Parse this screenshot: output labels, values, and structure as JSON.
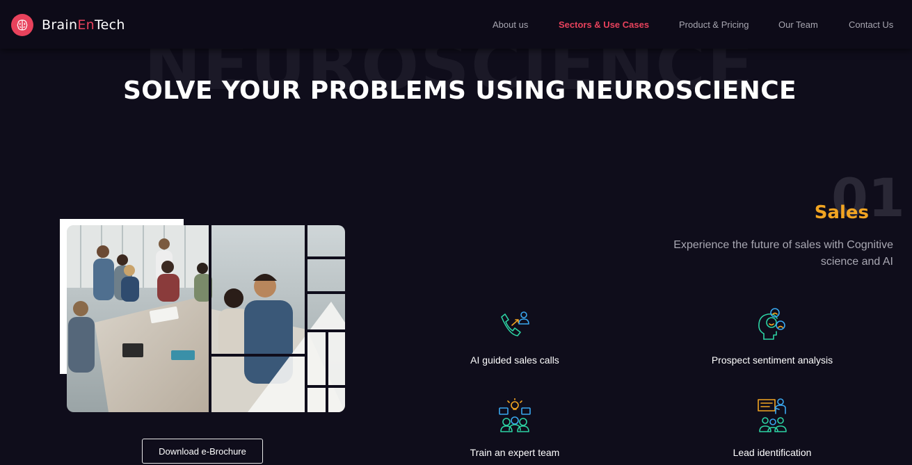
{
  "brand": {
    "name_parts": [
      "Brain",
      "En",
      "Tech"
    ],
    "accent_color": "#e8425c"
  },
  "nav": {
    "items": [
      {
        "label": "About us",
        "active": false
      },
      {
        "label": "Sectors & Use Cases",
        "active": true
      },
      {
        "label": "Product & Pricing",
        "active": false
      },
      {
        "label": "Our Team",
        "active": false
      },
      {
        "label": "Contact Us",
        "active": false
      }
    ]
  },
  "hero": {
    "background_word": "NEUROSCIENCE",
    "headline": "SOLVE YOUR PROBLEMS USING NEUROSCIENCE"
  },
  "cta": {
    "brochure_label": "Download e-Brochure"
  },
  "sector": {
    "number": "01",
    "title": "Sales",
    "title_color": "#f2a522",
    "description": "Experience the future of sales with Cognitive science and AI"
  },
  "features": [
    {
      "label": "AI guided sales calls",
      "icon": "phone-call-icon"
    },
    {
      "label": "Prospect sentiment analysis",
      "icon": "sentiment-faces-icon"
    },
    {
      "label": "Train an expert team",
      "icon": "team-training-icon"
    },
    {
      "label": "Lead identification",
      "icon": "presentation-icon"
    }
  ]
}
